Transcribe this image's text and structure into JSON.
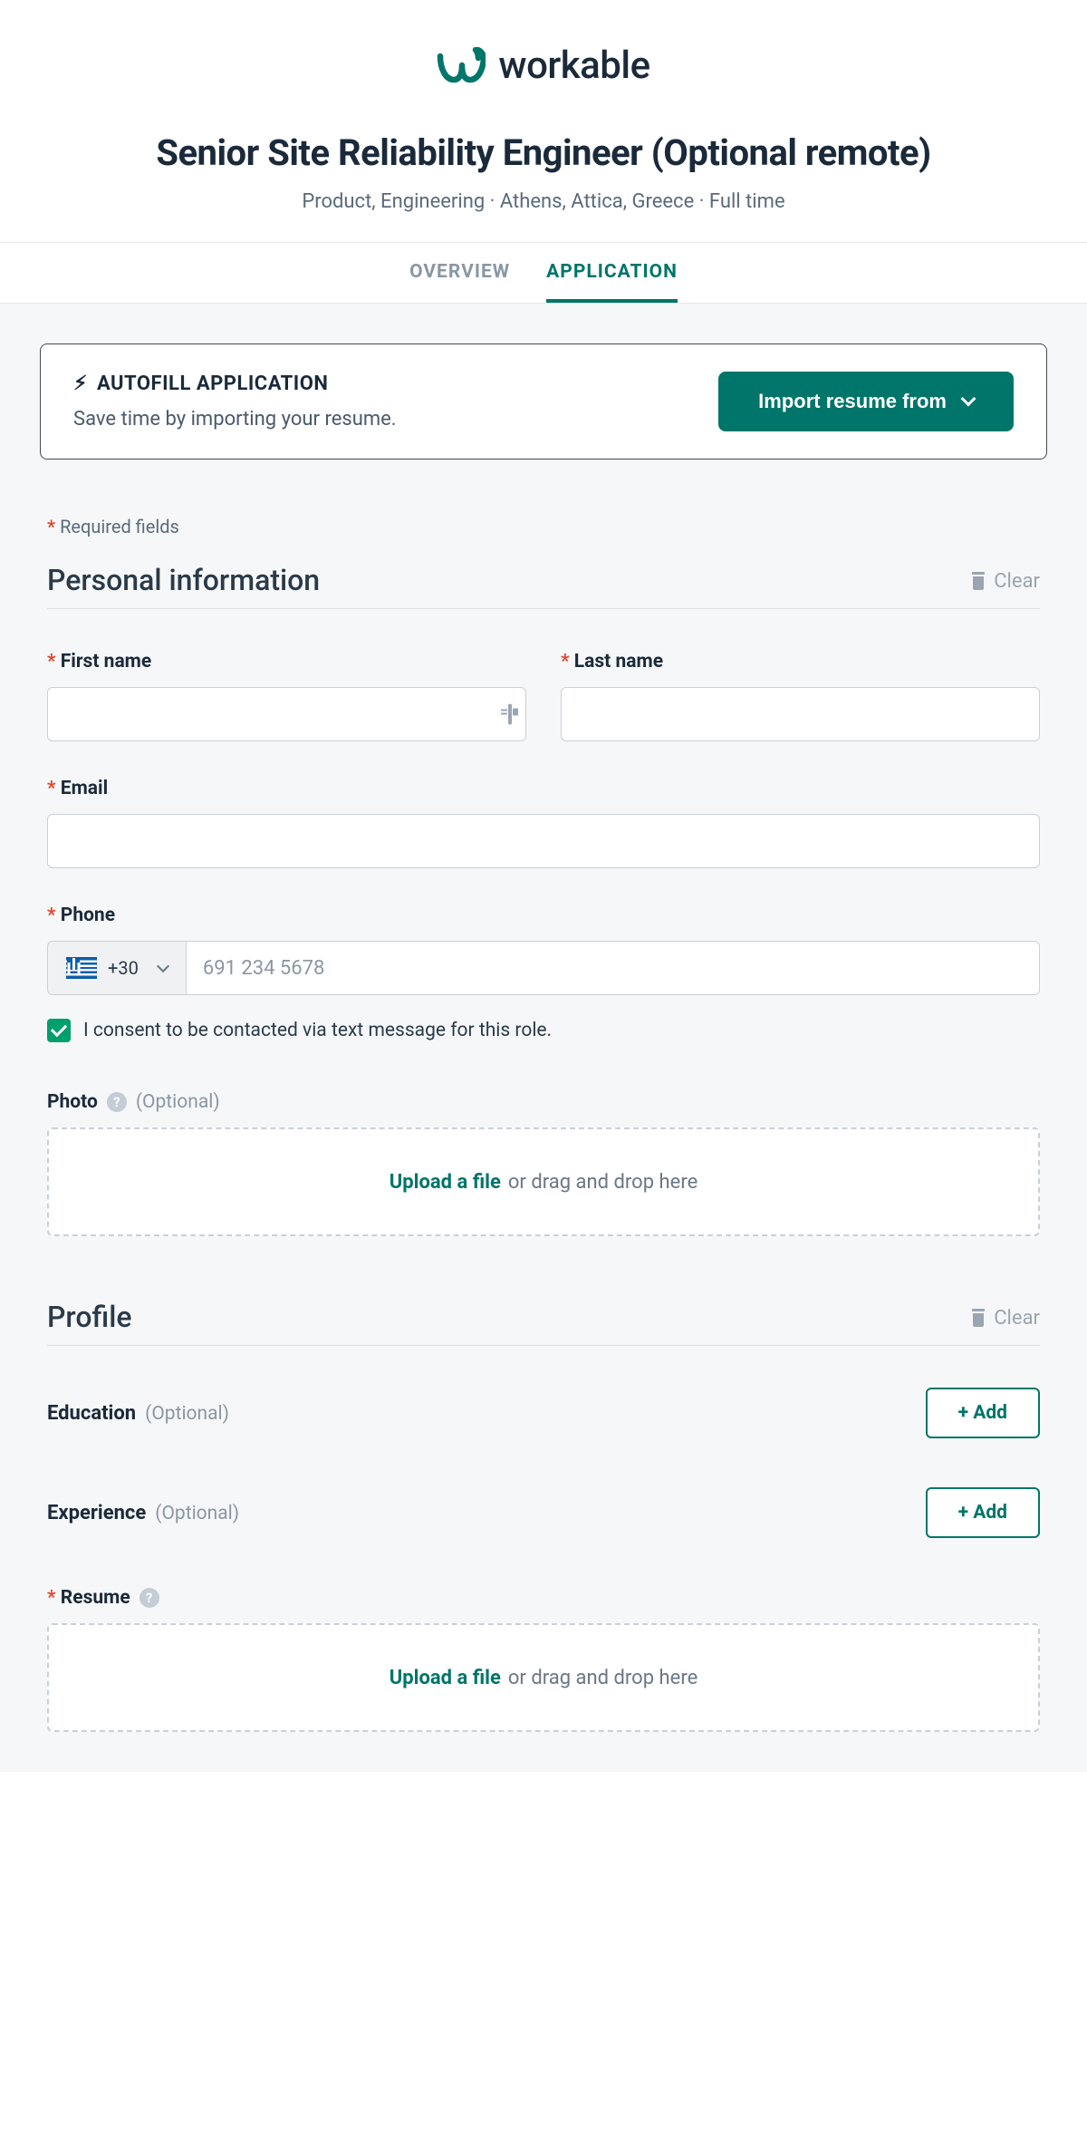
{
  "brand": "workable",
  "job": {
    "title": "Senior Site Reliability Engineer (Optional remote)",
    "meta": "Product, Engineering · Athens, Attica, Greece · Full time"
  },
  "tabs": {
    "overview": "OVERVIEW",
    "application": "APPLICATION"
  },
  "autofill": {
    "heading": "AUTOFILL APPLICATION",
    "sub": "Save time by importing your resume.",
    "import": "Import resume from"
  },
  "requiredNote": "Required fields",
  "sections": {
    "personal": {
      "title": "Personal information",
      "clear": "Clear",
      "firstName": "First name",
      "lastName": "Last name",
      "email": "Email",
      "phone": "Phone",
      "dialCode": "+30",
      "phonePlaceholder": "691 234 5678",
      "consent": "I consent to be contacted via text message for this role.",
      "photo": "Photo",
      "optional": "(Optional)"
    },
    "profile": {
      "title": "Profile",
      "clear": "Clear",
      "education": "Education",
      "experience": "Experience",
      "resume": "Resume",
      "add": "+ Add",
      "optional": "(Optional)"
    }
  },
  "dropzone": {
    "link": "Upload a file",
    "text": "or drag and drop here"
  }
}
